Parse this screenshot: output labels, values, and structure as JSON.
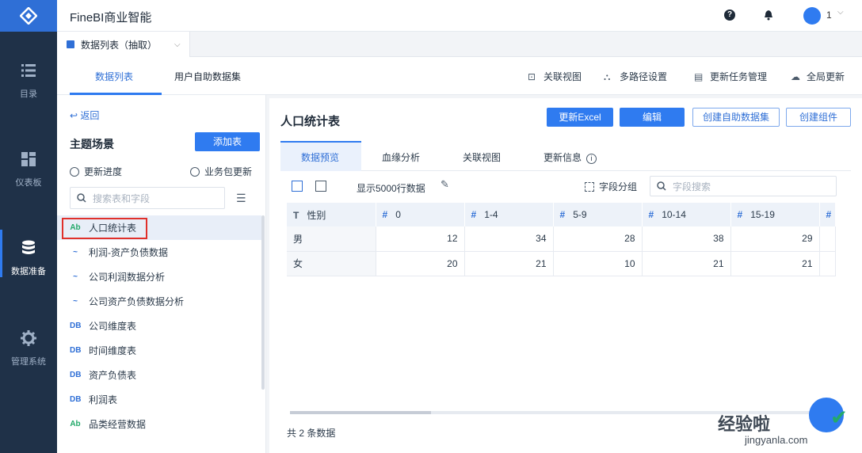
{
  "app": {
    "title": "FineBI商业智能",
    "user": "1"
  },
  "nav": [
    {
      "label": "目录",
      "icon": "list-icon"
    },
    {
      "label": "仪表板",
      "icon": "dashboard-icon"
    },
    {
      "label": "数据准备",
      "icon": "database-icon",
      "active": true
    },
    {
      "label": "管理系统",
      "icon": "gear-icon"
    }
  ],
  "filetab": {
    "label": "数据列表（抽取）"
  },
  "subtabs": [
    "数据列表",
    "用户自助数据集"
  ],
  "tools": [
    "关联视图",
    "多路径设置",
    "更新任务管理",
    "全局更新"
  ],
  "leftpanel": {
    "back": "返回",
    "title": "主题场景",
    "add_button": "添加表",
    "progress": "更新进度",
    "bizpkg": "业务包更新",
    "search_placeholder": "搜索表和字段",
    "items": [
      {
        "label": "人口统计表",
        "type": "table",
        "icon": "Ab",
        "selected": true
      },
      {
        "label": "利润-资产负债数据",
        "type": "analysis",
        "icon": "~"
      },
      {
        "label": "公司利润数据分析",
        "type": "analysis",
        "icon": "~"
      },
      {
        "label": "公司资产负债数据分析",
        "type": "analysis",
        "icon": "~"
      },
      {
        "label": "公司维度表",
        "type": "db",
        "icon": "DB"
      },
      {
        "label": "时间维度表",
        "type": "db",
        "icon": "DB"
      },
      {
        "label": "资产负债表",
        "type": "db",
        "icon": "DB"
      },
      {
        "label": "利润表",
        "type": "db",
        "icon": "DB"
      },
      {
        "label": "品类经营数据",
        "type": "table",
        "icon": "Ab"
      }
    ]
  },
  "main": {
    "title": "人口统计表",
    "buttons": [
      "更新Excel",
      "编辑",
      "创建自助数据集",
      "创建组件"
    ],
    "tabs": [
      "数据预览",
      "血缘分析",
      "关联视图",
      "更新信息"
    ],
    "rows_label": "显示5000行数据",
    "group_label": "字段分组",
    "field_search_placeholder": "字段搜索",
    "columns": [
      {
        "type": "T",
        "name": "性别"
      },
      {
        "type": "#",
        "name": "0"
      },
      {
        "type": "#",
        "name": "1-4"
      },
      {
        "type": "#",
        "name": "5-9"
      },
      {
        "type": "#",
        "name": "10-14"
      },
      {
        "type": "#",
        "name": "15-19"
      },
      {
        "type": "#",
        "name": ""
      }
    ],
    "rows": [
      [
        "男",
        "12",
        "34",
        "28",
        "38",
        "29",
        ""
      ],
      [
        "女",
        "20",
        "21",
        "10",
        "21",
        "21",
        ""
      ]
    ],
    "total": "共 2 条数据"
  },
  "watermark": {
    "main": "经验啦",
    "sub": "jingyanla.com"
  }
}
